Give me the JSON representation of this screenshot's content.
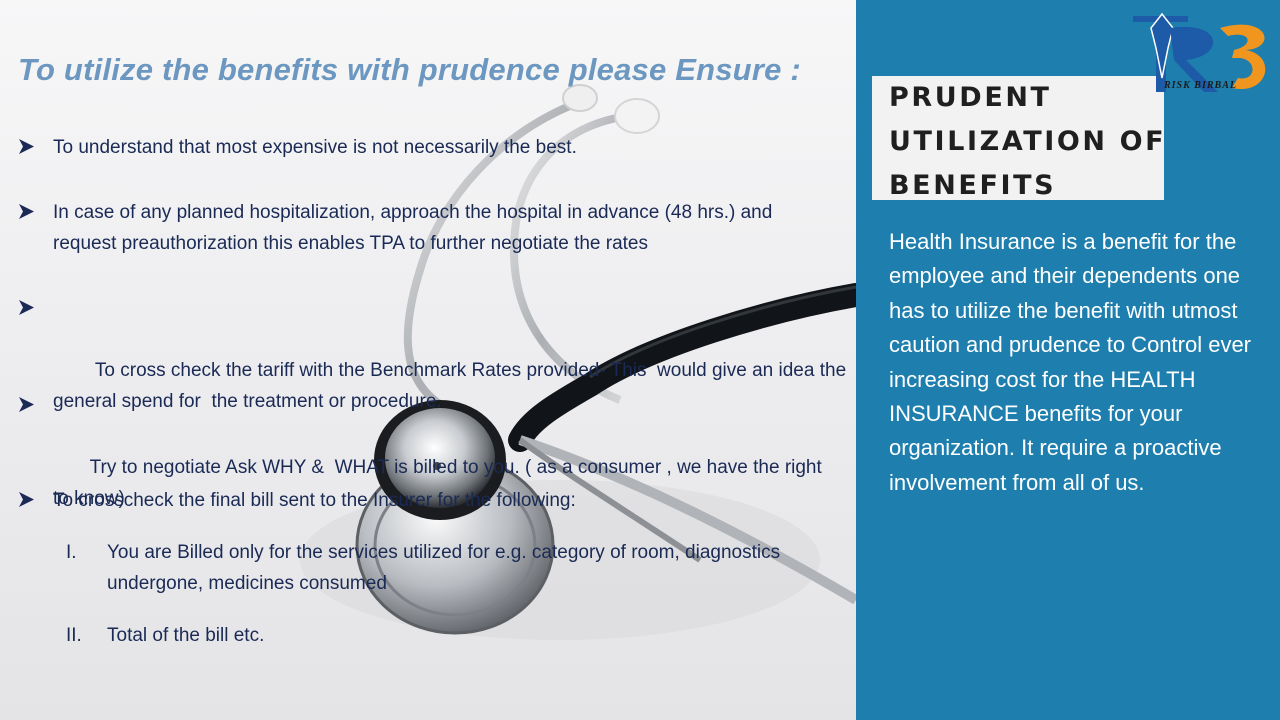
{
  "main": {
    "heading": "To utilize the benefits with prudence please Ensure :",
    "bullets": [
      "To understand that most expensive is not necessarily the best.",
      "In case of any planned hospitalization, approach the hospital in advance (48 hrs.) and request preauthorization this enables TPA to further negotiate the rates",
      "  To cross check the tariff with the Benchmark Rates provided- This  would give an idea the general spend for  the treatment or procedure.",
      " Try to negotiate Ask WHY &  WHAT is billed to you. ( as a consumer , we have the right to know)",
      "To crosscheck the final bill sent to the Insurer for the following:"
    ],
    "sub_items": [
      {
        "num": "I.",
        "text": "You are Billed only for the services utilized for e.g. category of room, diagnostics undergone, medicines consumed"
      },
      {
        "num": "II.",
        "text": "Total of the bill etc."
      }
    ]
  },
  "side": {
    "heading": "PRUDENT UTILIZATION OF BENEFITS",
    "body": "Health Insurance is a benefit for the employee and their dependents one has to utilize the benefit with utmost caution and prudence to Control ever increasing cost for the HEALTH INSURANCE benefits for your organization. It require a proactive involvement from all of us."
  },
  "logo": {
    "text": "RISK BIRBAL",
    "letters": "RB"
  },
  "colors": {
    "panel": "#1e7fae",
    "heading": "#6b97c0",
    "text": "#1a2a55",
    "logo_blue": "#1d5aa8",
    "logo_orange": "#f0961e"
  }
}
